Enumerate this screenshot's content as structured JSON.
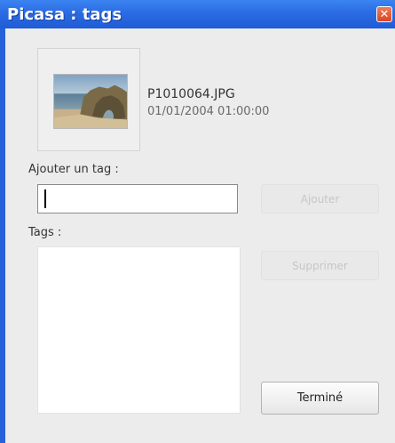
{
  "window": {
    "title": "Picasa : tags",
    "close_glyph": "✕"
  },
  "photo": {
    "filename": "P1010064.JPG",
    "datetime": "01/01/2004 01:00:00"
  },
  "add_tag": {
    "label": "Ajouter un tag :",
    "value": "",
    "button_label": "Ajouter"
  },
  "tags": {
    "label": "Tags :",
    "items": [],
    "remove_button_label": "Supprimer"
  },
  "done_button_label": "Terminé",
  "colors": {
    "titlebar": "#2b6be3",
    "close": "#d8461f",
    "client_bg": "#ececec"
  },
  "icons": {
    "close": "close-icon"
  }
}
